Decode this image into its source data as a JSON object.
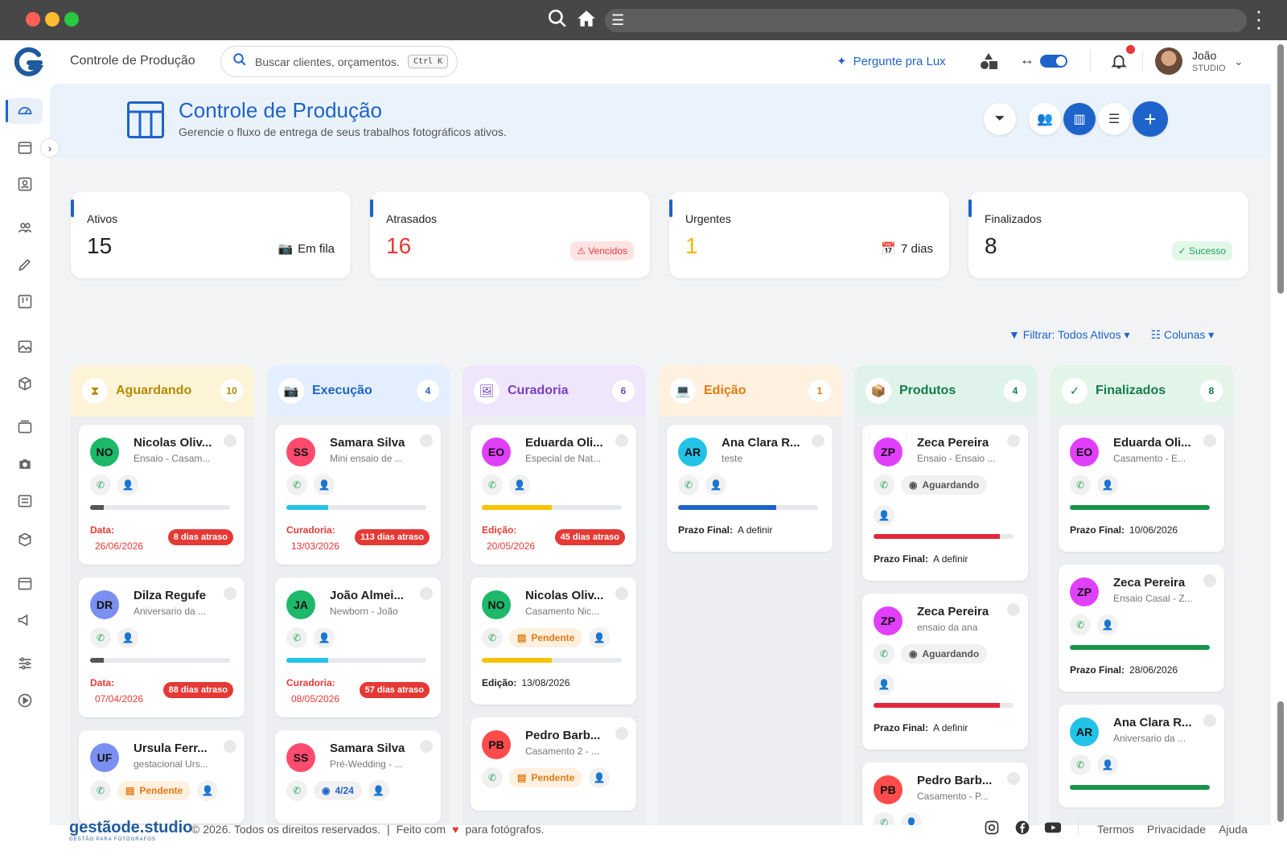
{
  "app": {
    "title": "Controle de Produção"
  },
  "search": {
    "placeholder": "Buscar clientes, orçamentos...",
    "shortcut": "Ctrl K"
  },
  "topbar": {
    "lux_label": "Pergunte pra Lux",
    "user_name": "João",
    "user_role": "STUDIO"
  },
  "header": {
    "title": "Controle de Produção",
    "subtitle": "Gerencie o fluxo de entrega de seus trabalhos fotográficos ativos."
  },
  "stats": [
    {
      "label": "Ativos",
      "value": "15",
      "right": "Em fila",
      "icon": "camera-icon"
    },
    {
      "label": "Atrasados",
      "value": "16",
      "right": "Vencidos",
      "icon": "warning-icon",
      "color": "#e53935"
    },
    {
      "label": "Urgentes",
      "value": "1",
      "right": "7 dias",
      "icon": "calendar-icon",
      "color": "#f2b705"
    },
    {
      "label": "Finalizados",
      "value": "8",
      "right": "Sucesso",
      "icon": "check-icon"
    }
  ],
  "filters": {
    "filter_label": "Filtrar: Todos Ativos",
    "columns_label": "Colunas"
  },
  "columns": [
    {
      "title": "Aguardando",
      "count": "10",
      "color": "#b58a00",
      "bg": "#fdf4d8",
      "icon": "hourglass-icon",
      "cards": [
        {
          "initials": "NO",
          "name": "Nicolas Oliv...",
          "desc": "Ensaio - Casam...",
          "avatar_color": "#1db86a",
          "label": "Data:",
          "date": "26/06/2026",
          "delay": "8 dias atraso",
          "progress": 0.1,
          "bar_color": "#555"
        },
        {
          "initials": "DR",
          "name": "Dilza Regufe",
          "desc": "Aniversario da ...",
          "avatar_color": "#7b8ff0",
          "label": "Data:",
          "date": "07/04/2026",
          "delay": "88 dias atraso",
          "progress": 0.1,
          "bar_color": "#555"
        },
        {
          "initials": "UF",
          "name": "Ursula Ferr...",
          "desc": "gestacional Urs...",
          "avatar_color": "#7b8ff0",
          "tag": "Pendente"
        }
      ]
    },
    {
      "title": "Execução",
      "count": "4",
      "color": "#1e63c9",
      "bg": "#e3efff",
      "icon": "camera-icon",
      "cards": [
        {
          "initials": "SS",
          "name": "Samara Silva",
          "desc": "Mini ensaio de ...",
          "avatar_color": "#ff4b6e",
          "label": "Curadoria:",
          "date": "13/03/2026",
          "delay": "113 dias atraso",
          "progress": 0.3,
          "bar_color": "#22c3e6"
        },
        {
          "initials": "JA",
          "name": "João Almei...",
          "desc": "Newborn - João",
          "avatar_color": "#1db86a",
          "label": "Curadoria:",
          "date": "08/05/2026",
          "delay": "57 dias atraso",
          "progress": 0.3,
          "bar_color": "#22c3e6"
        },
        {
          "initials": "SS",
          "name": "Samara Silva",
          "desc": "Pré-Wedding - ...",
          "avatar_color": "#ff4b6e",
          "tag": "4/24"
        }
      ]
    },
    {
      "title": "Curadoria",
      "count": "6",
      "color": "#7b3fc4",
      "bg": "#efe6fb",
      "icon": "gallery-icon",
      "cards": [
        {
          "initials": "EO",
          "name": "Eduarda Oli...",
          "desc": "Especial de Nat...",
          "avatar_color": "#e040fb",
          "label": "Edição:",
          "date": "20/05/2026",
          "delay": "45 dias atraso",
          "progress": 0.5,
          "bar_color": "#f5c400"
        },
        {
          "initials": "NO",
          "name": "Nicolas Oliv...",
          "desc": "Casamento Nic...",
          "avatar_color": "#1db86a",
          "tag": "Pendente",
          "progress": 0.5,
          "bar_color": "#f5c400",
          "prazo_label": "Edição:",
          "prazo_value": "13/08/2026"
        },
        {
          "initials": "PB",
          "name": "Pedro Barb...",
          "desc": "Casamento 2 - ...",
          "avatar_color": "#ff4b4b",
          "tag": "Pendente"
        }
      ]
    },
    {
      "title": "Edição",
      "count": "1",
      "color": "#e07a10",
      "bg": "#fff1e0",
      "icon": "laptop-icon",
      "cards": [
        {
          "initials": "AR",
          "name": "Ana Clara R...",
          "desc": "teste",
          "avatar_color": "#22c3e6",
          "progress": 0.7,
          "bar_color": "#1e63c9",
          "prazo_label": "Prazo Final:",
          "prazo_value": "A definir"
        }
      ]
    },
    {
      "title": "Produtos",
      "count": "4",
      "color": "#137a4a",
      "bg": "#e0f3ea",
      "icon": "box-icon",
      "cards": [
        {
          "initials": "ZP",
          "name": "Zeca Pereira",
          "desc": "Ensaio - Ensaio ...",
          "avatar_color": "#e040fb",
          "tag": "Aguardando",
          "progress": 0.9,
          "bar_color": "#e0283a",
          "prazo_label": "Prazo Final:",
          "prazo_value": "A definir"
        },
        {
          "initials": "ZP",
          "name": "Zeca Pereira",
          "desc": "ensaio da ana",
          "avatar_color": "#e040fb",
          "tag": "Aguardando",
          "progress": 0.9,
          "bar_color": "#e0283a",
          "prazo_label": "Prazo Final:",
          "prazo_value": "A definir"
        },
        {
          "initials": "PB",
          "name": "Pedro Barb...",
          "desc": "Casamento - P...",
          "avatar_color": "#ff4b4b"
        }
      ]
    },
    {
      "title": "Finalizados",
      "count": "8",
      "color": "#137a4a",
      "bg": "#e3f5e9",
      "icon": "check-icon",
      "cards": [
        {
          "initials": "EO",
          "name": "Eduarda Oli...",
          "desc": "Casamento - E...",
          "avatar_color": "#e040fb",
          "progress": 1.0,
          "bar_color": "#17934a",
          "prazo_label": "Prazo Final:",
          "prazo_value": "10/06/2026"
        },
        {
          "initials": "ZP",
          "name": "Zeca Pereira",
          "desc": "Ensaio Casal - Z...",
          "avatar_color": "#e040fb",
          "progress": 1.0,
          "bar_color": "#17934a",
          "prazo_label": "Prazo Final:",
          "prazo_value": "28/06/2026"
        },
        {
          "initials": "AR",
          "name": "Ana Clara R...",
          "desc": "Aniversario da ...",
          "avatar_color": "#22c3e6",
          "progress": 1.0,
          "bar_color": "#17934a"
        }
      ]
    }
  ],
  "footer": {
    "brand": "gestãode.studio",
    "brand_tagline": "GESTÃO PARA FOTÓGRAFOS",
    "copyright": "© 2026. Todos os direitos reservados.",
    "made_with": "Feito com",
    "for": "para fotógrafos.",
    "links": [
      "Termos",
      "Privacidade",
      "Ajuda"
    ]
  }
}
